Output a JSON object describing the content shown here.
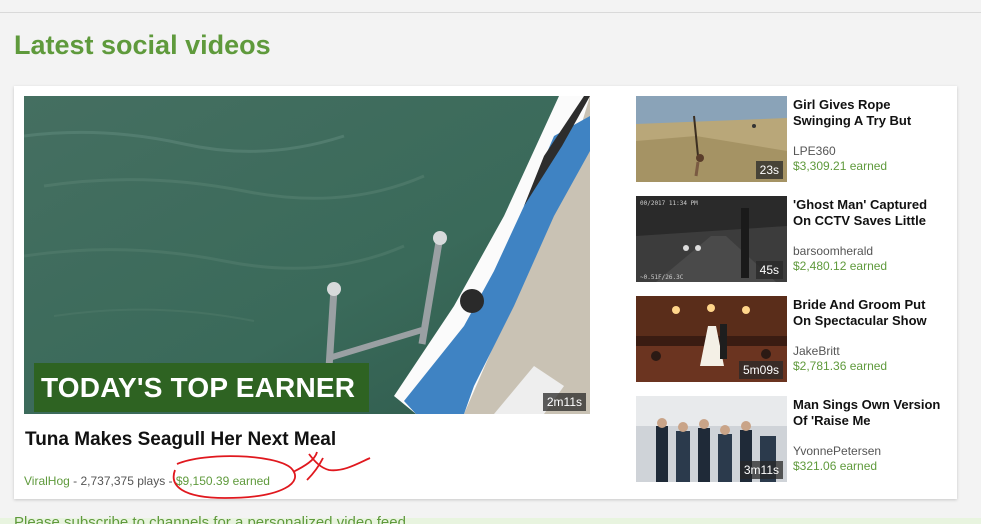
{
  "section": {
    "title": "Latest social videos"
  },
  "feature": {
    "badge": "TODAY'S TOP EARNER",
    "duration": "2m11s",
    "title": "Tuna Makes Seagull Her Next Meal",
    "user": "ViralHog",
    "plays": " - 2,737,375 plays - ",
    "earned": "$9,150.39 earned"
  },
  "side": [
    {
      "title": "Girl Gives Rope Swinging A Try But",
      "user": "LPE360",
      "earned": "$3,309.21 earned",
      "duration": "23s"
    },
    {
      "title": "'Ghost Man' Captured On CCTV Saves Little",
      "user": "barsoomherald",
      "earned": "$2,480.12 earned",
      "duration": "45s"
    },
    {
      "title": "Bride And Groom Put On Spectacular Show",
      "user": "JakeBritt",
      "earned": "$2,781.36 earned",
      "duration": "5m09s"
    },
    {
      "title": "Man Sings Own Version Of 'Raise Me",
      "user": "YvonnePetersen",
      "earned": "$321.06 earned",
      "duration": "3m11s"
    }
  ],
  "footer": {
    "text": "Please subscribe to channels for a personalized video feed"
  },
  "colors": {
    "accent": "#5f9a3c",
    "badge": "#2e6322",
    "annotation": "#e0181e"
  }
}
